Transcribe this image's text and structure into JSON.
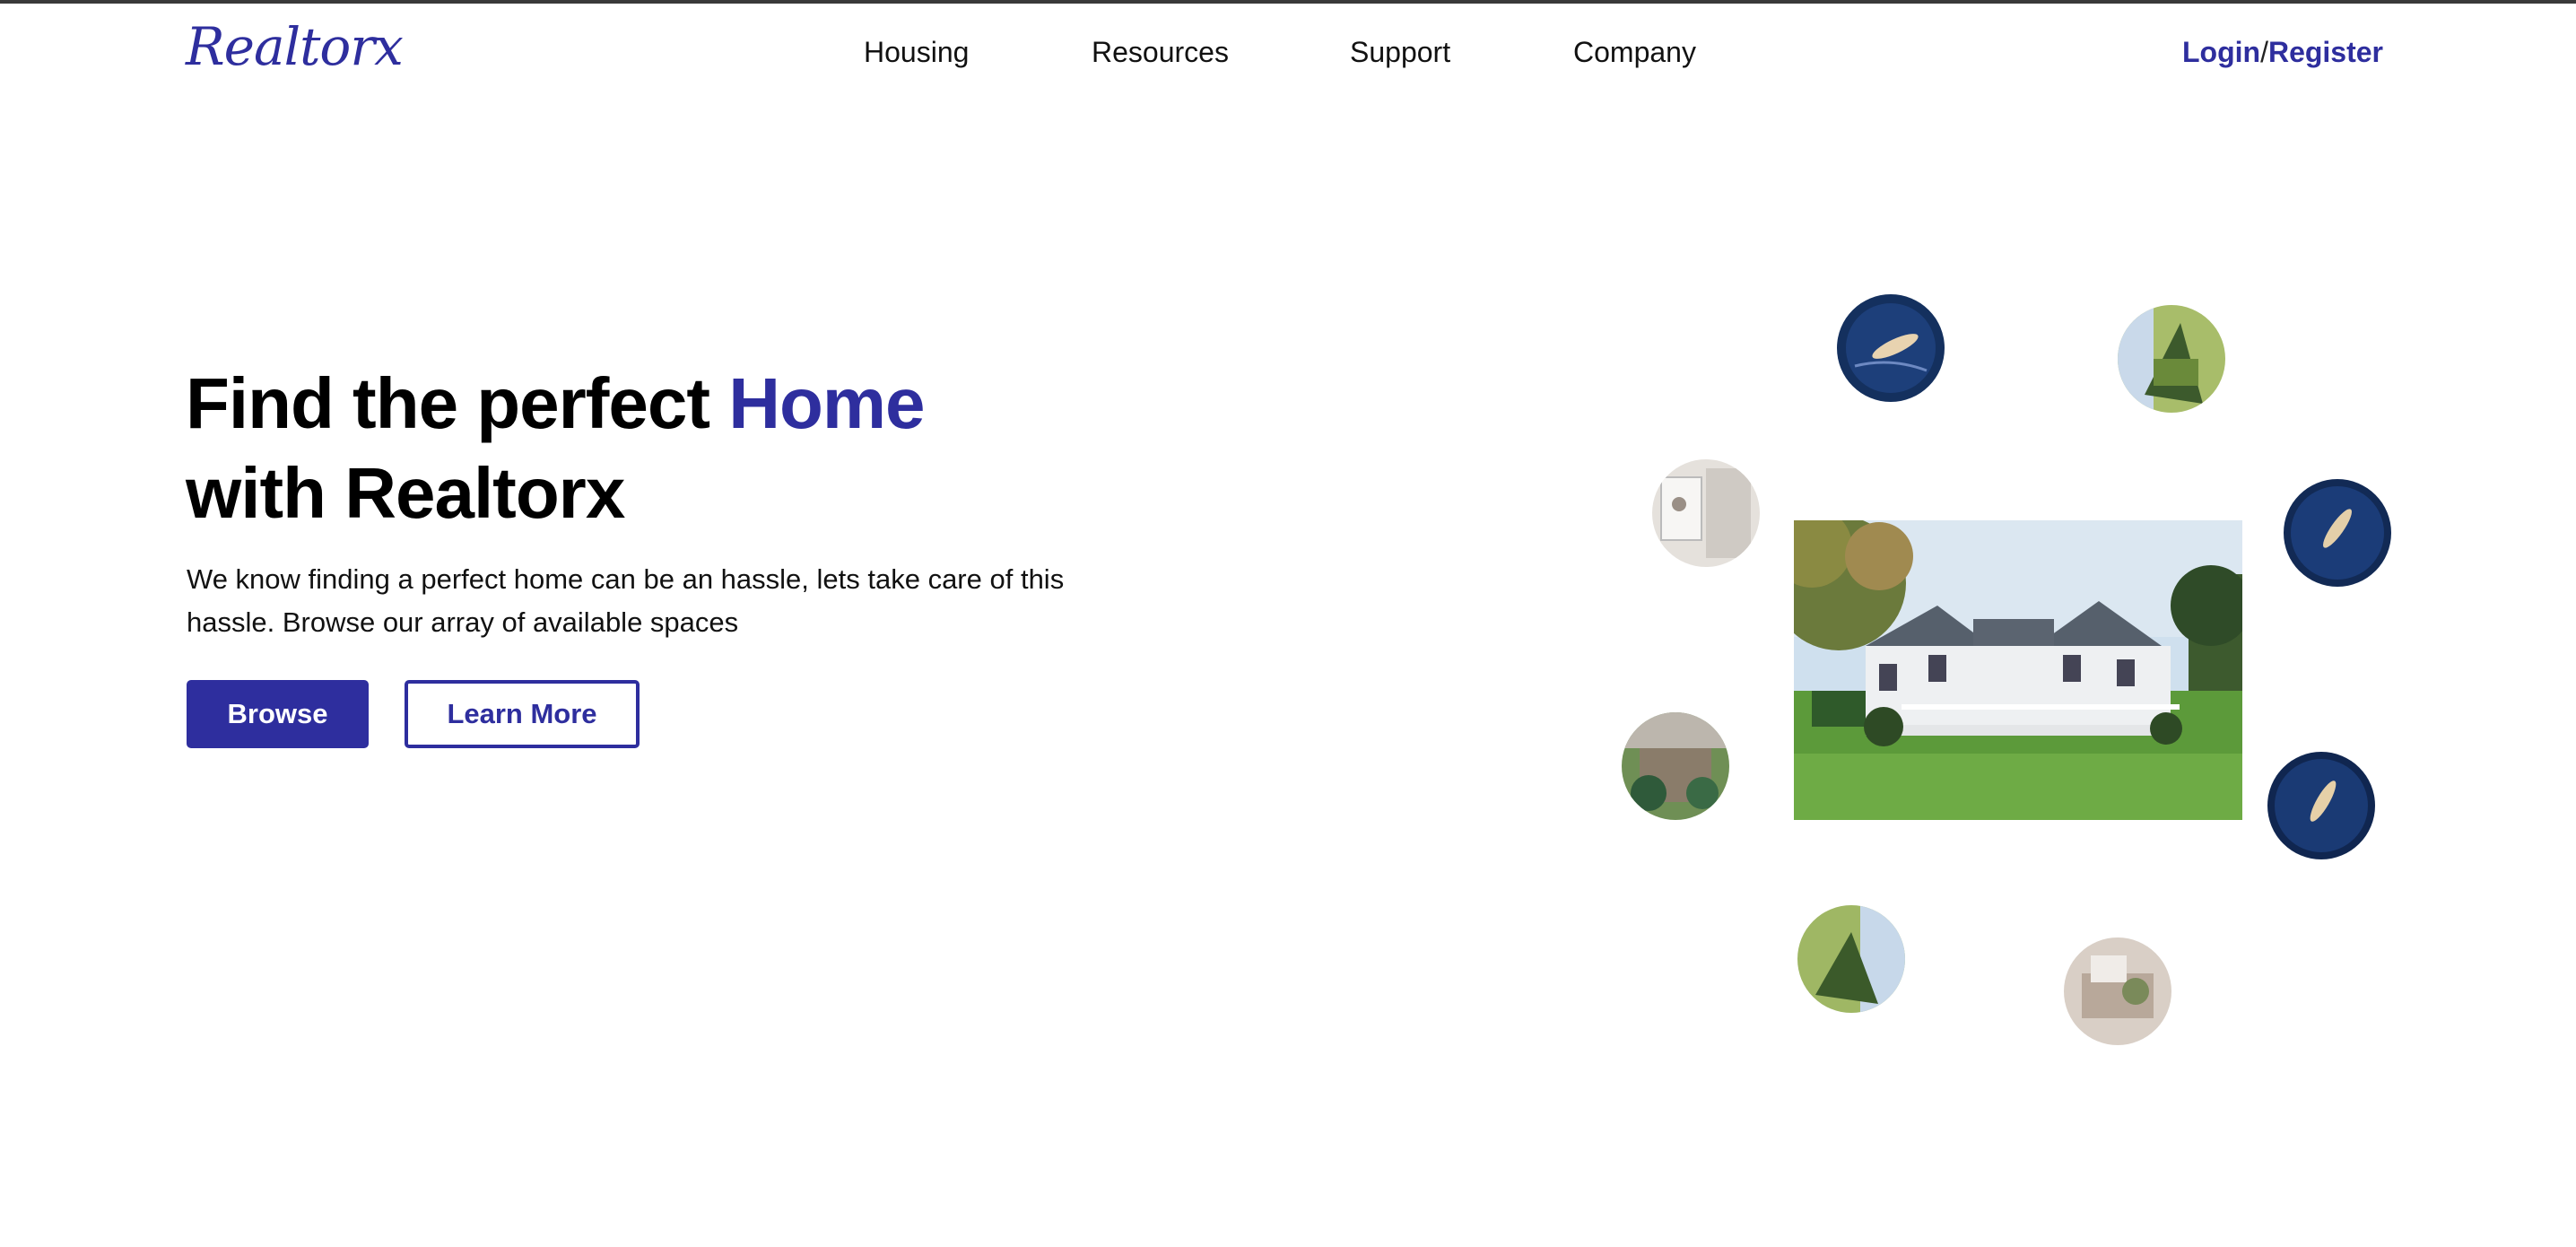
{
  "brand": {
    "logo": "Realtorx",
    "accent_color": "#2e2e9e"
  },
  "nav": {
    "items": [
      {
        "label": "Housing"
      },
      {
        "label": "Resources"
      },
      {
        "label": "Support"
      },
      {
        "label": "Company"
      }
    ],
    "login": "Login",
    "separator": "/",
    "register": "Register"
  },
  "hero": {
    "title_part1": "Find the perfect ",
    "title_highlight": "Home",
    "title_part2": "with Realtorx",
    "description": "We know finding a perfect home can be an hassle, lets take care of this hassle. Browse our array of available spaces",
    "browse_label": "Browse",
    "learn_more_label": "Learn More"
  },
  "gallery": {
    "main_image": "house-photo",
    "thumbnails": [
      {
        "name": "pool-swimmer-photo"
      },
      {
        "name": "garden-photo"
      },
      {
        "name": "bathroom-photo"
      },
      {
        "name": "pool-swimmer-photo"
      },
      {
        "name": "patio-photo"
      },
      {
        "name": "pool-swimmer-photo"
      },
      {
        "name": "garden-photo"
      },
      {
        "name": "living-room-photo"
      }
    ]
  }
}
